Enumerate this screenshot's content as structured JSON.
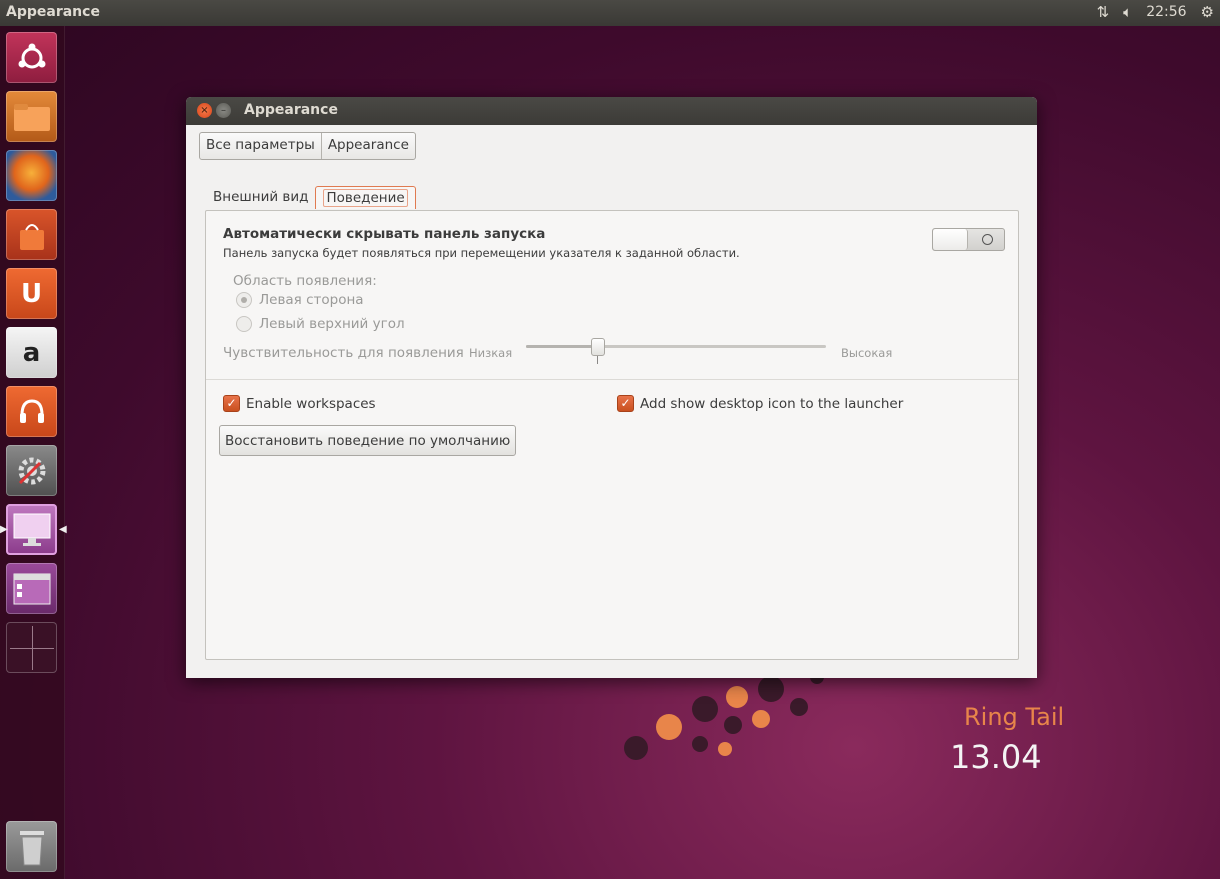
{
  "top_panel": {
    "app_name": "Appearance",
    "clock": "22:56",
    "network_icon": "network-transfer-icon",
    "sound_icon": "speaker-icon",
    "system_icon": "gear-icon"
  },
  "launcher": {
    "amazon_letter": "a",
    "ubuntuone_letter": "U"
  },
  "wallpaper": {
    "codename": "Ring Tail",
    "version": "13.04"
  },
  "window": {
    "title": "Appearance",
    "breadcrumb": [
      "Все параметры",
      "Appearance"
    ],
    "tabs": [
      "Внешний вид",
      "Поведение"
    ],
    "active_tab": "Поведение",
    "behavior": {
      "autohide_title": "Автоматически скрывать панель запуска",
      "autohide_desc": "Панель запуска будет появляться при перемещении указателя к заданной области.",
      "autohide_enabled": false,
      "reveal_location_label": "Область появления:",
      "reveal_options": [
        "Левая сторона",
        "Левый верхний угол"
      ],
      "reveal_selected": "Левая сторона",
      "sensitivity_label": "Чувствительность для появления",
      "sensitivity_low": "Низкая",
      "sensitivity_high": "Высокая",
      "sensitivity_value": 0.24,
      "enable_workspaces": "Enable workspaces",
      "enable_workspaces_checked": true,
      "show_desktop": "Add show desktop icon to the launcher",
      "show_desktop_checked": true,
      "reset_button": "Восстановить поведение по умолчанию"
    }
  },
  "colors": {
    "accent": "#dd4814",
    "panel_bg": "#3c3b37",
    "window_bg": "#f2f1f0"
  }
}
